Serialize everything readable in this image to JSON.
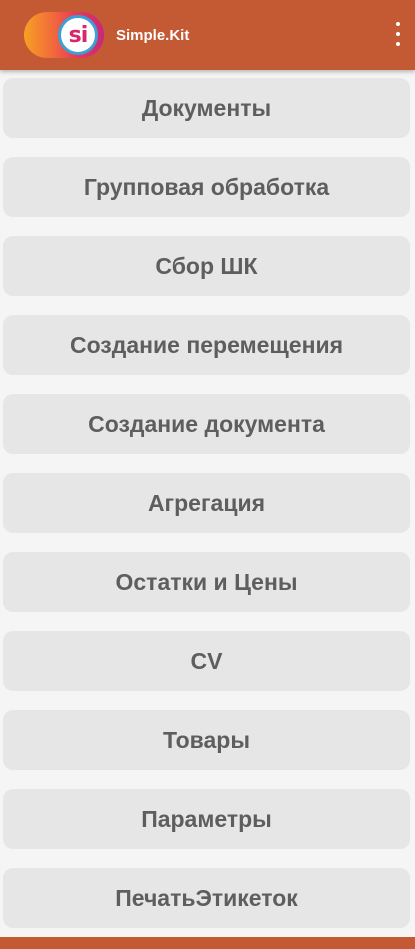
{
  "app": {
    "title": "Simple.Kit",
    "logo_text": "si"
  },
  "colors": {
    "appbar": "#c45a34",
    "button_bg": "#e6e6e6",
    "button_text": "#5e5e5e",
    "background": "#f5f5f5"
  },
  "menu": {
    "icon": "more-vert-icon",
    "items": [
      {
        "label": "Документы"
      },
      {
        "label": "Групповая обработка"
      },
      {
        "label": "Сбор ШК"
      },
      {
        "label": "Создание перемещения"
      },
      {
        "label": "Создание документа"
      },
      {
        "label": "Агрегация"
      },
      {
        "label": "Остатки и Цены"
      },
      {
        "label": "CV"
      },
      {
        "label": "Товары"
      },
      {
        "label": "Параметры"
      },
      {
        "label": "ПечатьЭтикеток"
      }
    ]
  }
}
